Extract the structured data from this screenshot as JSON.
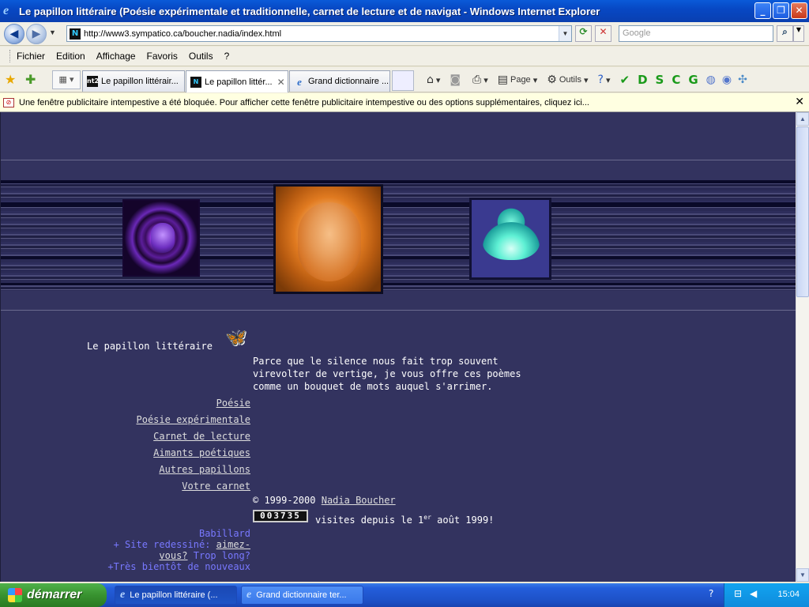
{
  "window": {
    "title": "Le papillon littéraire (Poésie expérimentale et traditionnelle, carnet de lecture et de navigat - Windows Internet Explorer"
  },
  "address": {
    "url": "http://www3.sympatico.ca/boucher.nadia/index.html",
    "search_placeholder": "Google"
  },
  "menu": [
    "Fichier",
    "Edition",
    "Affichage",
    "Favoris",
    "Outils",
    "?"
  ],
  "tabs": [
    {
      "label": "Le papillon littérair...",
      "favicon": "nt2"
    },
    {
      "label": "Le papillon littér...",
      "favicon": "N"
    },
    {
      "label": "Grand dictionnaire ...",
      "favicon": "ie"
    }
  ],
  "command_bar": {
    "page_label": "Page",
    "tools_label": "Outils",
    "letters": [
      "D",
      "S",
      "C",
      "G"
    ]
  },
  "popup_bar": {
    "text": "Une fenêtre publicitaire intempestive a été bloquée. Pour afficher cette fenêtre publicitaire intempestive ou des options supplémentaires, cliquez ici..."
  },
  "page": {
    "site_title": "Le papillon littéraire",
    "intro": "Parce que le silence nous fait trop souvent\nvirevolter de vertige, je vous offre ces poèmes\ncomme un bouquet de mots auquel s'arrimer.",
    "nav": [
      "Poésie",
      "Poésie expérimentale",
      "Carnet de lecture",
      "Aimants poétiques",
      "Autres papillons",
      "Votre carnet"
    ],
    "copyright_prefix": "© 1999-2000",
    "author": "Nadia Boucher",
    "counter": "003735",
    "visits_text": "visites depuis le 1",
    "visits_sup": "er",
    "visits_tail": " août 1999!",
    "babillard": {
      "title": "Babillard",
      "line1_pre": "+ Site redessiné: ",
      "line1_link": "aimez-",
      "line2_link": "vous?",
      "line2_post": " Trop long?",
      "line3": "+Très bientôt de nouveaux"
    }
  },
  "taskbar": {
    "start_label": "démarrer",
    "items": [
      "Le papillon littéraire (...",
      "Grand dictionnaire ter..."
    ],
    "clock": "15:04"
  },
  "colors": {
    "page_bg": "#33335f",
    "link": "#dddddd",
    "babillard": "#7878ff"
  }
}
